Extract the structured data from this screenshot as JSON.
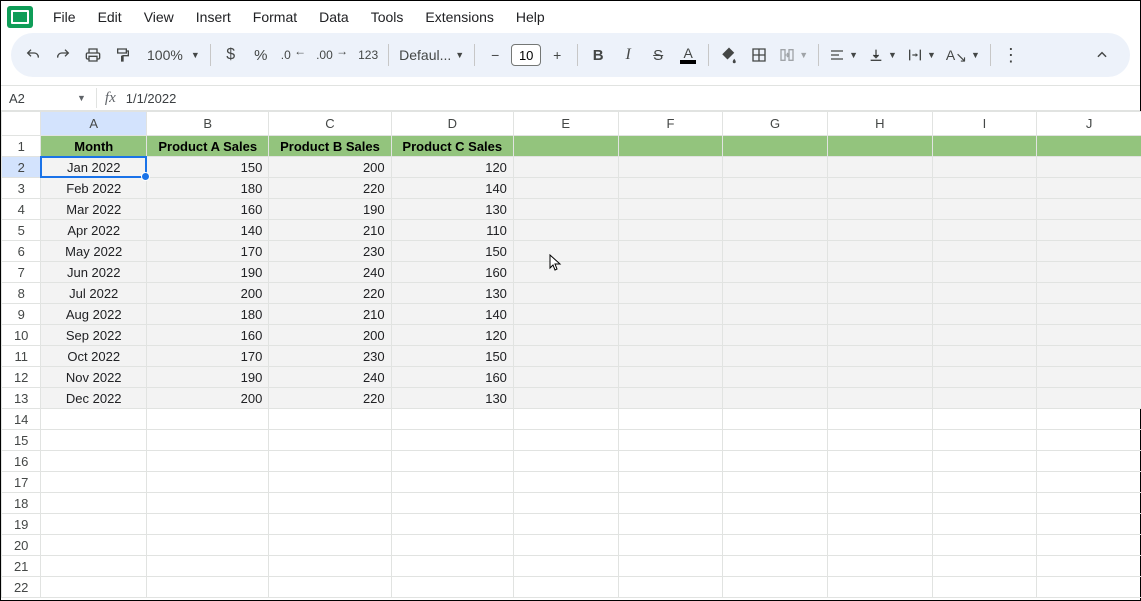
{
  "menu": {
    "items": [
      "File",
      "Edit",
      "View",
      "Insert",
      "Format",
      "Data",
      "Tools",
      "Extensions",
      "Help"
    ]
  },
  "toolbar": {
    "zoom": "100%",
    "font": "Defaul...",
    "fontsize": "10"
  },
  "namebox": "A2",
  "formula": "1/1/2022",
  "columns": [
    "A",
    "B",
    "C",
    "D",
    "E",
    "F",
    "G",
    "H",
    "I",
    "J"
  ],
  "row_count": 22,
  "selected_col": 0,
  "selected_row": 2,
  "headers": [
    "Month",
    "Product A Sales",
    "Product B Sales",
    "Product C Sales"
  ],
  "rows": [
    [
      "Jan 2022",
      150,
      200,
      120
    ],
    [
      "Feb 2022",
      180,
      220,
      140
    ],
    [
      "Mar 2022",
      160,
      190,
      130
    ],
    [
      "Apr 2022",
      140,
      210,
      110
    ],
    [
      "May 2022",
      170,
      230,
      150
    ],
    [
      "Jun 2022",
      190,
      240,
      160
    ],
    [
      "Jul 2022",
      200,
      220,
      130
    ],
    [
      "Aug 2022",
      180,
      210,
      140
    ],
    [
      "Sep 2022",
      160,
      200,
      120
    ],
    [
      "Oct 2022",
      170,
      230,
      150
    ],
    [
      "Nov 2022",
      190,
      240,
      160
    ],
    [
      "Dec 2022",
      200,
      220,
      130
    ]
  ]
}
